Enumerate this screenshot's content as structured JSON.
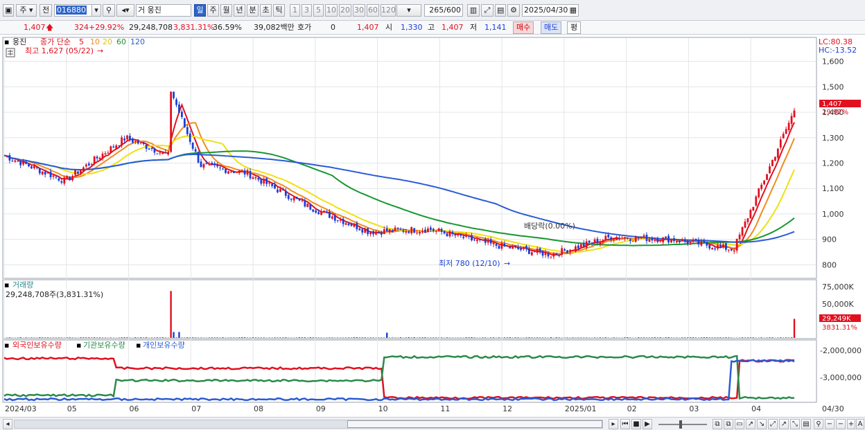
{
  "toolbar": {
    "market_label": "주",
    "prev_label": "전",
    "code": "016880",
    "stock_name": "웅진",
    "name_prefix": "거",
    "periods": [
      "일",
      "주",
      "월",
      "년",
      "분",
      "초",
      "틱"
    ],
    "selected_period": "일",
    "multipliers": [
      "1",
      "3",
      "5",
      "10",
      "20",
      "30",
      "60",
      "120"
    ],
    "count": "265",
    "count_max": "/600",
    "date": "2025/04/30"
  },
  "info": {
    "price": "1,407",
    "change": "324",
    "change_pct": "+29.92%",
    "volume": "29,248,708",
    "volume_ratio": "3,831.31%",
    "turnover": "36.59%",
    "amount": "39,082백만",
    "quote_label": "호가",
    "quote_value": "0",
    "quote_price": "1,407",
    "open_label": "시",
    "open": "1,330",
    "high_label": "고",
    "high": "1,407",
    "low_label": "저",
    "low": "1,141",
    "buy_label": "매수",
    "sell_label": "매도",
    "avg_label": "평"
  },
  "price_panel": {
    "title": "웅진",
    "ma_label": "종가 단순",
    "ma_periods": [
      "5",
      "10",
      "20",
      "60",
      "120"
    ],
    "high_note": "최고 1,627 (05/22)",
    "low_note": "최저 780 (12/10)",
    "dividend_note": "배당락(0.00%)",
    "lc": "LC:80.38",
    "hc": "HC:-13.52",
    "last_price_tag": "1,407",
    "last_pct_tag": "29.92%",
    "y_ticks": [
      "1,600",
      "1,500",
      "1,400",
      "1,300",
      "1,200",
      "1,100",
      "1,000",
      "900",
      "800"
    ]
  },
  "volume_panel": {
    "title": "거래량",
    "summary": "29,248,708주(3,831.31%)",
    "y_ticks": [
      "75,000K",
      "50,000K"
    ],
    "last_tag": "29,249K",
    "last_pct": "3831.31%"
  },
  "holdings_panel": {
    "legend": [
      "외국인보유수량",
      "기관보유수량",
      "개인보유수량"
    ],
    "y_ticks": [
      "-2,000,000",
      "-3,000,000"
    ]
  },
  "x_axis": {
    "labels": [
      "2024/03",
      "05",
      "06",
      "07",
      "08",
      "09",
      "10",
      "11",
      "12",
      "2025/01",
      "02",
      "03",
      "04"
    ],
    "last_label": "04/30"
  },
  "colors": {
    "up": "#e1101f",
    "down": "#1a3fd6",
    "ma5": "#e1101f",
    "ma10": "#f08c1e",
    "ma20": "#f0e010",
    "ma60": "#17962f",
    "ma120": "#2a5bd7",
    "foreign": "#e1101f",
    "institution": "#2a8a4a",
    "individual": "#2a5bd7"
  },
  "chart_data": {
    "type": "candlestick",
    "ylim": [
      760,
      1640
    ],
    "approx_monthly_close": [
      {
        "month": "2024/03",
        "close": 1230
      },
      {
        "month": "2024/04",
        "close": 1130
      },
      {
        "month": "2024/05",
        "close": 1300
      },
      {
        "month": "2024/06",
        "close": 1200
      },
      {
        "month": "2024/07",
        "close": 1160
      },
      {
        "month": "2024/08",
        "close": 1030
      },
      {
        "month": "2024/09",
        "close": 930
      },
      {
        "month": "2024/10",
        "close": 940
      },
      {
        "month": "2024/11",
        "close": 880
      },
      {
        "month": "2024/12",
        "close": 840
      },
      {
        "month": "2025/01",
        "close": 910
      },
      {
        "month": "2025/02",
        "close": 900
      },
      {
        "month": "2025/03",
        "close": 860
      },
      {
        "month": "2025/04",
        "close": 1407
      }
    ],
    "last_candle": {
      "open": 1330,
      "high": 1407,
      "low": 1141,
      "close": 1407,
      "volume": 29248708
    }
  }
}
